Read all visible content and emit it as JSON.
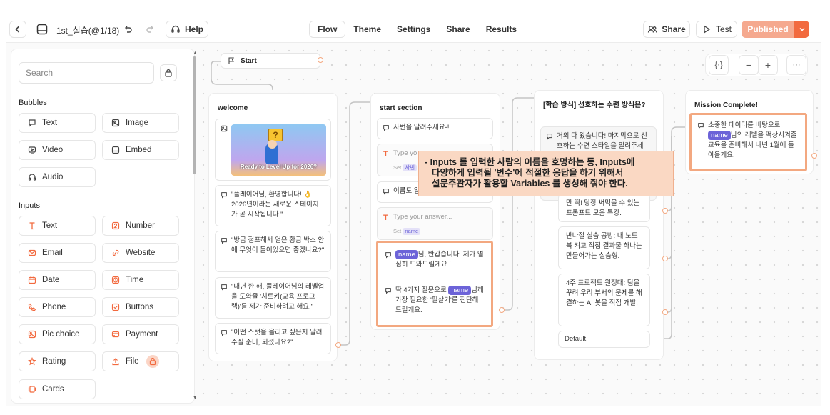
{
  "topbar": {
    "project_name": "1st_실습(@1/18)",
    "help_label": "Help",
    "nav": [
      "Flow",
      "Theme",
      "Settings",
      "Share",
      "Results"
    ],
    "active_nav": "Flow",
    "share_label": "Share",
    "test_label": "Test",
    "publish_label": "Published"
  },
  "sidebar": {
    "search_placeholder": "Search",
    "bubbles_title": "Bubbles",
    "bubbles": [
      {
        "label": "Text",
        "icon": "chat-bubble-icon"
      },
      {
        "label": "Image",
        "icon": "image-icon"
      },
      {
        "label": "Video",
        "icon": "video-icon"
      },
      {
        "label": "Embed",
        "icon": "embed-icon"
      },
      {
        "label": "Audio",
        "icon": "headphones-icon"
      }
    ],
    "inputs_title": "Inputs",
    "inputs": [
      {
        "label": "Text",
        "icon": "text-cursor-icon"
      },
      {
        "label": "Number",
        "icon": "number-icon"
      },
      {
        "label": "Email",
        "icon": "mail-icon"
      },
      {
        "label": "Website",
        "icon": "link-icon"
      },
      {
        "label": "Date",
        "icon": "calendar-icon"
      },
      {
        "label": "Time",
        "icon": "clock-icon"
      },
      {
        "label": "Phone",
        "icon": "phone-icon"
      },
      {
        "label": "Buttons",
        "icon": "checkbox-icon"
      },
      {
        "label": "Pic choice",
        "icon": "picture-icon"
      },
      {
        "label": "Payment",
        "icon": "card-icon"
      },
      {
        "label": "Rating",
        "icon": "star-icon"
      },
      {
        "label": "File",
        "icon": "upload-icon"
      },
      {
        "label": "Cards",
        "icon": "cards-icon"
      }
    ]
  },
  "canvas": {
    "start_label": "Start",
    "welcome": {
      "title": "welcome",
      "image_caption": "Ready to Level Up for 2026?",
      "messages": [
        "\"플레이어님, 환영합니다! 👌 2026년이라는 새로운 스테이지가 곧 시작됩니다.\"",
        "\"방금 점프해서 얻은 황금 박스 안에 무엇이 들어있으면 좋겠나요?\"",
        "\"내년 한 해, 플레이어님의 레벨업을 도와줄 '치트키(교육 프로그램)'를 제가 준비하려고 해요.\"",
        "\"어떤 스탯을 올리고 싶은지 알려주실 준비, 되셨나요?\""
      ]
    },
    "start_section": {
      "title": "start section",
      "msg1": "사번을 알려주세요-!",
      "input1_placeholder": "Type yo",
      "input1_set": "Set",
      "input1_var": "사번",
      "msg2": "이름도 알",
      "input2_placeholder": "Type your answer...",
      "input2_set": "Set",
      "input2_var": "name",
      "msg3_var": "name",
      "msg3_text": "님, 반갑습니다. 제가 열심히 도와드릴게요 !",
      "msg4_pre": "딱 4가지 질문으로",
      "msg4_var": "name",
      "msg4_post": "님께 가장 필요한 '필살기'를 진단해 드릴게요."
    },
    "learning": {
      "title": "[학습 방식] 선호하는 수련 방식은?",
      "msg": "거의 다 왔습니다! 마지막으로 선호하는 수련 스타일을 알려주세",
      "options": [
        "만 딱! 당장 써먹을 수 있는 프롬프트 모음 특강.",
        "반나절 실습 공방: 내 노트북 켜고 직접 결과물 하나는 만들어가는 실습형.",
        "4주 프로젝트 원정대: 팀을 꾸려 우리 부서의 문제를 해결하는 AI 봇을 직접 개발."
      ],
      "default_label": "Default"
    },
    "mission": {
      "title": "Mission Complete!",
      "pre": "소중한 데이터를 바탕으로",
      "var": "name",
      "post": "님의 레벨을 떡상시켜줄 교육을 준비해서 내년 1월에 돌아올게요."
    },
    "callout": [
      "- Inputs 를 입력한 사람의 이름을 호명하는 등, Inputs에",
      "  다양하게 입력될 '변수'에 적절한 응답을 하기 위해서",
      "  설문주관자가 활용할 Variables 를 생성해 줘야 한다."
    ]
  },
  "colors": {
    "accent": "#f26a3f",
    "publish_bg": "#f5a98f",
    "variable": "#6c63d8",
    "highlight": "#f3a880",
    "callout_bg": "#fad8c3"
  }
}
